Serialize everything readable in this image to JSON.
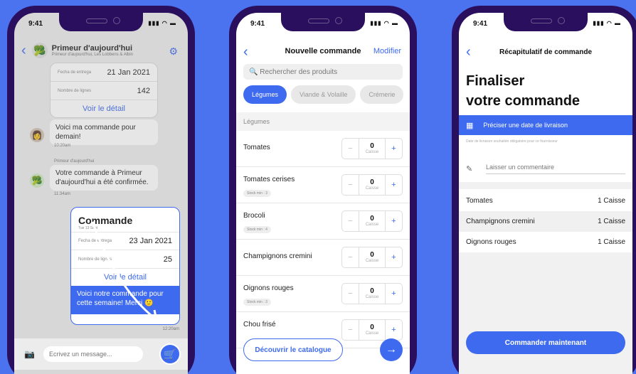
{
  "status_time": "9:41",
  "status_icons": "▮▮▮ ◠ ▬",
  "chat": {
    "title": "Primeur d'aujourd'hui",
    "subtitle": "Primeur d'aujourd'hui, Les Lobbens & Albin",
    "card1": {
      "delivery_label": "Fecha de entrega",
      "delivery_value": "21 Jan 2021",
      "lines_label": "Nombre de lignes",
      "lines_value": "142",
      "link": "Voir le détail"
    },
    "msg1": "Voici ma commande pour demain!",
    "msg1_time": "10:20am",
    "sender_label": "Primeur d'aujourd'hui",
    "msg2": "Votre commande à Primeur d'aujourd'hui a été confirmée.",
    "msg2_time": "11:34am",
    "card2": {
      "title": "Commande",
      "date": "Tue 13 Sept",
      "delivery_label": "Fecha de entrega",
      "delivery_value": "23 Jan 2021",
      "lines_label": "Nombre de lignes",
      "lines_value": "25",
      "link": "Voir le détail",
      "message": "Voici notre commande pour cette semaine! Merci 🙂",
      "time": "12:20am"
    },
    "input_placeholder": "Ecrivez un message...",
    "camera_icon": "camera-icon",
    "cart_icon": "cart-plus-icon"
  },
  "order": {
    "title": "Nouvelle commande",
    "edit": "Modifier",
    "search_placeholder": "Rechercher des produits",
    "chips": [
      "Légumes",
      "Viande & Volaille",
      "Crémerie"
    ],
    "section": "Légumes",
    "products": [
      {
        "name": "Tomates",
        "stock": "",
        "qty": "0",
        "unit": "Caisse"
      },
      {
        "name": "Tomates cerises",
        "stock": "Stock min : 3",
        "qty": "0",
        "unit": "Caisse"
      },
      {
        "name": "Brocoli",
        "stock": "Stock min : 4",
        "qty": "0",
        "unit": "Caisse"
      },
      {
        "name": "Champignons cremini",
        "stock": "",
        "qty": "0",
        "unit": "Caisse"
      },
      {
        "name": "Oignons rouges",
        "stock": "Stock min : 3",
        "qty": "0",
        "unit": "Caisse"
      },
      {
        "name": "Chou frisé",
        "stock": "",
        "qty": "0",
        "unit": "Caisse"
      }
    ],
    "catalog_btn": "Découvrir le catalogue"
  },
  "summary": {
    "nav_title": "Récapitulatif de commande",
    "title_line1": "Finaliser",
    "title_line2": "votre commande",
    "date_btn": "Préciser une date de livraison",
    "date_note": "Date de livraison souhaitée obligatoire pour ce fournisseur",
    "comment_placeholder": "Laisser un commentaire",
    "items": [
      {
        "name": "Tomates",
        "qty": "1 Caisse"
      },
      {
        "name": "Champignons cremini",
        "qty": "1 Caisse"
      },
      {
        "name": "Oignons rouges",
        "qty": "1 Caisse"
      }
    ],
    "cta": "Commander maintenant"
  },
  "colors": {
    "accent": "#3E6AF0",
    "background": "#4B73F0",
    "phone_frame": "#2A0F5E"
  }
}
